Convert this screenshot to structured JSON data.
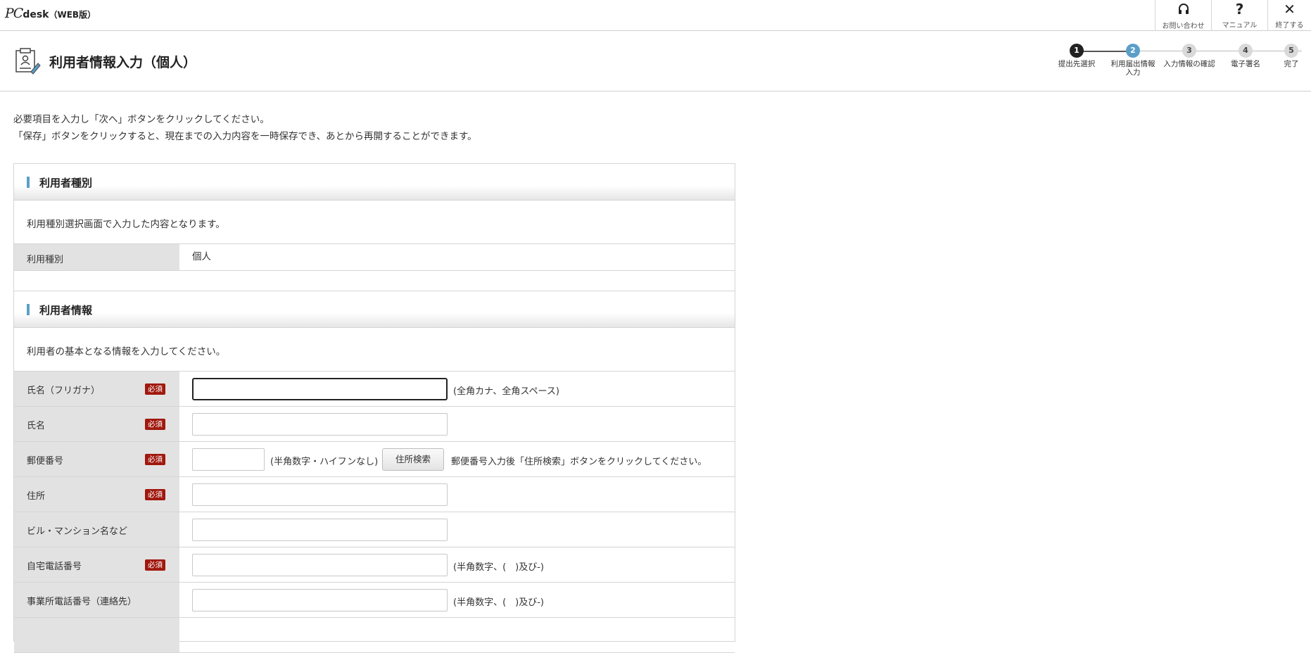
{
  "header": {
    "logo_pc": "PC",
    "logo_desk": "desk",
    "logo_web": "（WEB版）",
    "buttons": [
      {
        "label": "お問い合わせ",
        "icon": "headset-icon"
      },
      {
        "label": "マニュアル",
        "icon": "question-icon",
        "glyph": "?"
      },
      {
        "label": "終了する",
        "icon": "close-icon",
        "glyph": "✕"
      }
    ]
  },
  "page": {
    "title": "利用者情報入力（個人）",
    "steps": [
      {
        "num": "1",
        "label": "提出先選択",
        "state": "done"
      },
      {
        "num": "2",
        "label": "利用届出情報入力",
        "state": "active"
      },
      {
        "num": "3",
        "label": "入力情報の確認",
        "state": "pending"
      },
      {
        "num": "4",
        "label": "電子署名",
        "state": "pending"
      },
      {
        "num": "5",
        "label": "完了",
        "state": "pending"
      }
    ],
    "intro_line1": "必要項目を入力し「次へ」ボタンをクリックしてください。",
    "intro_line2": "「保存」ボタンをクリックすると、現在までの入力内容を一時保存でき、あとから再開することができます。"
  },
  "section_type": {
    "title": "利用者種別",
    "desc": "利用種別選択画面で入力した内容となります。",
    "row_label": "利用種別",
    "row_value": "個人"
  },
  "section_info": {
    "title": "利用者情報",
    "desc": "利用者の基本となる情報を入力してください。",
    "required_badge": "必須",
    "rows": {
      "furigana": {
        "label": "氏名（フリガナ）",
        "value": "",
        "note": "(全角カナ、全角スペース)"
      },
      "name": {
        "label": "氏名",
        "value": ""
      },
      "postal": {
        "label": "郵便番号",
        "value": "",
        "note": "(半角数字・ハイフンなし)",
        "button": "住所検索",
        "hint": "郵便番号入力後「住所検索」ボタンをクリックしてください。"
      },
      "address": {
        "label": "住所",
        "value": ""
      },
      "building": {
        "label": "ビル・マンション名など",
        "value": ""
      },
      "home_phone": {
        "label": "自宅電話番号",
        "value": "",
        "note": "(半角数字、(　)及び-)"
      },
      "office_phone": {
        "label": "事業所電話番号（連絡先）",
        "value": "",
        "note": "(半角数字、(　)及び-)"
      }
    }
  }
}
